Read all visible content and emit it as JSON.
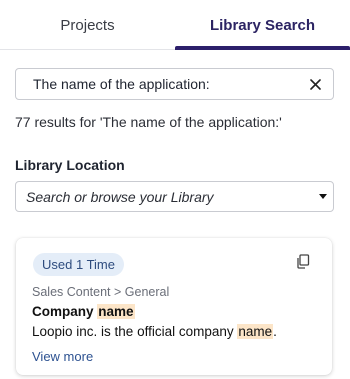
{
  "tabs": {
    "projects": "Projects",
    "library_search": "Library Search"
  },
  "search": {
    "value": "The name of the application:",
    "clear_icon": "close-icon"
  },
  "results": {
    "count_text": "77 results for 'The name of the application:'"
  },
  "library_location": {
    "label": "Library Location",
    "placeholder": "Search or browse your Library",
    "dropdown_icon": "caret-down-icon"
  },
  "result_card": {
    "usage_badge": "Used 1 Time",
    "copy_icon": "copy-icon",
    "breadcrumb": "Sales Content > General",
    "question": {
      "prefix": "Company ",
      "highlight": "name"
    },
    "answer": {
      "prefix": "Loopio inc. is the official company ",
      "highlight": "name",
      "suffix": "."
    },
    "view_more": "View more"
  },
  "colors": {
    "active_tab_indicator": "#2c1f6b",
    "badge_bg": "#e4edf8",
    "highlight": "#fce5c8",
    "link": "#2d5291"
  }
}
